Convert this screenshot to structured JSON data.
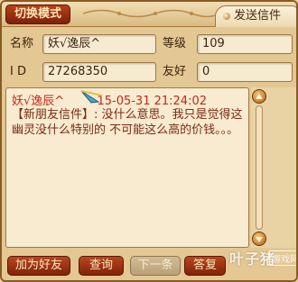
{
  "topbar": {
    "mode_tab": "切换模式",
    "send_tab": "发送信件"
  },
  "info": {
    "name_label": "名称",
    "name_value": "妖√逸辰^",
    "level_label": "等级",
    "level_value": "109",
    "id_label": "I D",
    "id_value": "27268350",
    "friendship_label": "友好",
    "friendship_value": "0"
  },
  "message": {
    "sender": "妖√逸辰^",
    "date_fragment": "15-05-31 21:24:02",
    "body": "【新朋友信件】: 没什么意思。我只是觉得这幽灵没什么特别的   不可能这么高的价钱。。。"
  },
  "buttons": {
    "add_friend": "加为好友",
    "query": "查询",
    "next": "下一条",
    "reply": "答复"
  },
  "watermark": {
    "text": "叶子猪",
    "sub": "游戏网"
  },
  "colors": {
    "accent": "#9a3212",
    "sender_red": "#c8261a",
    "body_brown": "#7a2b14"
  }
}
